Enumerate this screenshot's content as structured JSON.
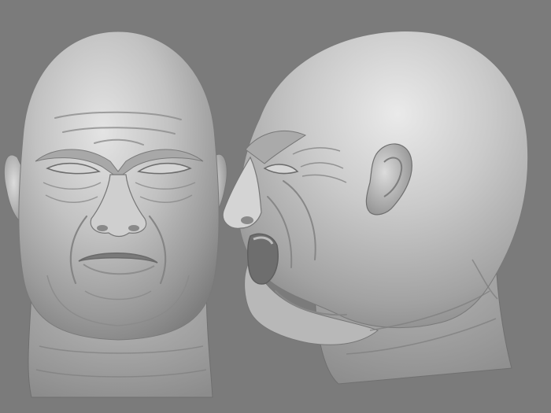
{
  "scene": {
    "background_color": "#7b7b7b",
    "surface_color": "#c4c4c4",
    "objects": [
      {
        "kind": "sculpted-head",
        "view": "front",
        "expression": "scowl"
      },
      {
        "kind": "sculpted-head",
        "view": "side-profile",
        "expression": "shouting"
      }
    ]
  }
}
